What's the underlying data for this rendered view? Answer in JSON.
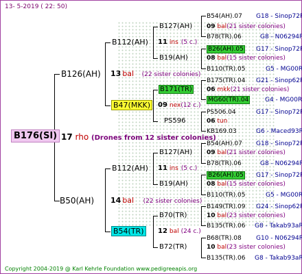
{
  "date": "13-  5-2019 (  22: 50)",
  "root": {
    "name": "B176(SI)",
    "num": "17",
    "breed": "rho",
    "note": "(Drones from 12 sister colonies)"
  },
  "g1": [
    {
      "name": "B126(AH)",
      "num": "13",
      "breed": "bal",
      "note": "(22 sister colonies)"
    },
    {
      "name": "B50(AH)",
      "num": "14",
      "breed": "bal",
      "note": "(22 sister colonies)"
    }
  ],
  "g2": [
    {
      "name": "B112(AH)",
      "num": "11",
      "breed": "ins",
      "note": "(5 c.)"
    },
    {
      "name": "B47(MKK)",
      "num": "09",
      "breed": "nex",
      "note": "(12 c.)"
    },
    {
      "name": "B112(AH)",
      "num": "11",
      "breed": "ins",
      "note": "(5 c.)"
    },
    {
      "name": "B54(TR)",
      "num": "12",
      "breed": "bal",
      "note": "(24 c.)"
    }
  ],
  "g3": [
    {
      "name": "B127(AH)",
      "num": "09",
      "breed": "bal",
      "note": "(21 sister colonies)"
    },
    {
      "name": "B19(AH)",
      "num": "08",
      "breed": "bal",
      "note": "(15 sister colonies)"
    },
    {
      "name": "B171(TR)",
      "num": "06",
      "breed": "mkk",
      "note": "(21 sister colonies)"
    },
    {
      "name": "PS596",
      "num": "06",
      "breed": "tun",
      "note": ""
    },
    {
      "name": "B127(AH)",
      "num": "09",
      "breed": "bal",
      "note": "(21 sister colonies)"
    },
    {
      "name": "B19(AH)",
      "num": "08",
      "breed": "bal",
      "note": "(15 sister colonies)"
    },
    {
      "name": "B70(TR)",
      "num": "10",
      "breed": "bal",
      "note": "(23 sister colonies)"
    },
    {
      "name": "B72(TR)",
      "num": "10",
      "breed": "bal",
      "note": "(23 sister colonies)"
    }
  ],
  "g4": [
    {
      "name": "B54(AH).07",
      "col": "G18 - Sinop72R"
    },
    {
      "name": "B78(TR).06",
      "col": "G8 - N06294R"
    },
    {
      "name": "B26(AH).05",
      "col": "G17 - Sinop72R"
    },
    {
      "name": "B110(TR).05",
      "col": "G5 - MG00R"
    },
    {
      "name": "B175(TR).04",
      "col": "G21 - Sinop62R"
    },
    {
      "name": "MG60(TR).04",
      "col": "G4 - MG00R"
    },
    {
      "name": "PS506.04",
      "col": "G17 - Sinop72R"
    },
    {
      "name": "KB169.03",
      "col": "G6 - Maced93R"
    },
    {
      "name": "B54(AH).07",
      "col": "G18 - Sinop72R"
    },
    {
      "name": "B78(TR).06",
      "col": "G8 - N06294R"
    },
    {
      "name": "B26(AH).05",
      "col": "G17 - Sinop72R"
    },
    {
      "name": "B110(TR).05",
      "col": "G5 - MG00R"
    },
    {
      "name": "B149(TR).09",
      "col": "G24 - Sinop62R"
    },
    {
      "name": "B135(TR).06",
      "col": "G8 - Takab93aR"
    },
    {
      "name": "B68(TR).08",
      "col": "G10 - N06294R"
    },
    {
      "name": "B135(TR).06",
      "col": "G8 - Takab93aR"
    }
  ],
  "footer": "Copyright 2004-2019 @ Karl Kehrle Foundation    www.pedigreeapis.org"
}
